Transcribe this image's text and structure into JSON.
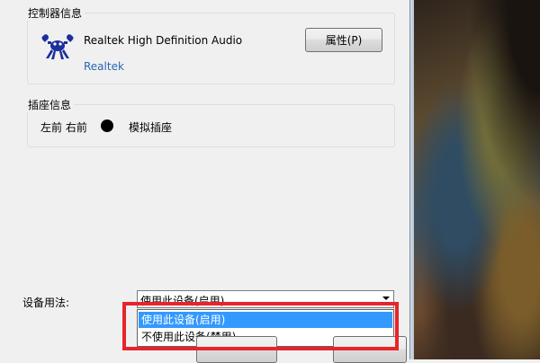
{
  "controller": {
    "group_title": "控制器信息",
    "device_name": "Realtek High Definition Audio",
    "manufacturer": "Realtek",
    "properties_button": "属性(P)"
  },
  "jack": {
    "group_title": "插座信息",
    "positions": "左前 右前",
    "jack_type": "模拟插座",
    "dot_color": "#000000"
  },
  "usage": {
    "label": "设备用法:",
    "selected": "使用此设备(启用)",
    "options": [
      "使用此设备(启用)",
      "不使用此设备(禁用)"
    ],
    "highlight_color": "#e8242b",
    "selection_color": "#3399ff"
  }
}
